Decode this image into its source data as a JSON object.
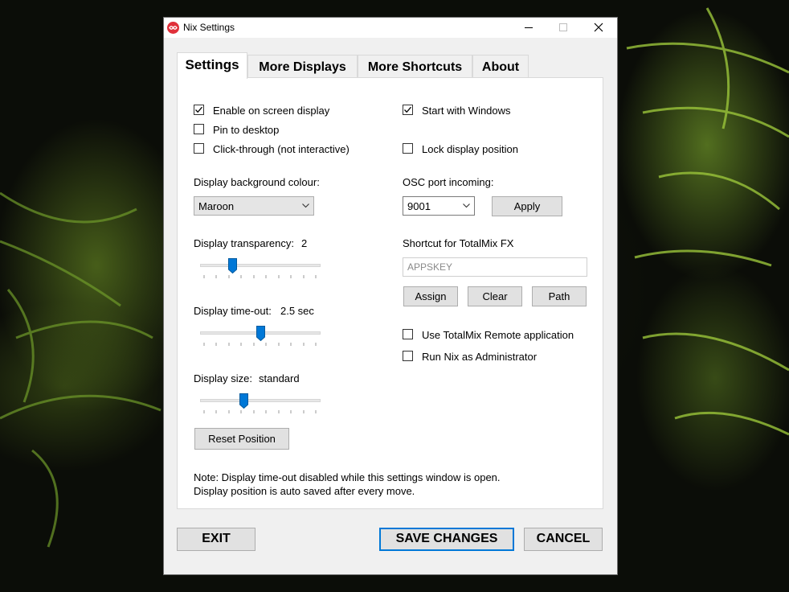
{
  "window": {
    "title": "Nix Settings"
  },
  "tabs": [
    "Settings",
    "More Displays",
    "More Shortcuts",
    "About"
  ],
  "settings": {
    "enable_osd": {
      "label": "Enable on screen display",
      "checked": true
    },
    "pin_desktop": {
      "label": "Pin to desktop",
      "checked": false
    },
    "click_through": {
      "label": "Click-through (not interactive)",
      "checked": false
    },
    "start_windows": {
      "label": "Start with Windows",
      "checked": true
    },
    "lock_position": {
      "label": "Lock display position",
      "checked": false
    },
    "bg_colour": {
      "label": "Display background colour:",
      "value": "Maroon"
    },
    "osc_port": {
      "label": "OSC port incoming:",
      "value": "9001",
      "apply_label": "Apply"
    },
    "transparency": {
      "label": "Display transparency:",
      "value": "2",
      "fraction": 0.25
    },
    "timeout": {
      "label": "Display time-out:",
      "value": "2.5 sec",
      "fraction": 0.5
    },
    "size": {
      "label": "Display size:",
      "value": "standard",
      "fraction": 0.35
    },
    "shortcut": {
      "label": "Shortcut for TotalMix FX",
      "value": "APPSKEY",
      "assign": "Assign",
      "clear": "Clear",
      "path": "Path"
    },
    "use_remote": {
      "label": "Use TotalMix Remote application",
      "checked": false
    },
    "run_admin": {
      "label": "Run Nix as Administrator",
      "checked": false
    },
    "reset_position": "Reset Position",
    "note_line1": "Note: Display time-out disabled while this settings window is open.",
    "note_line2": "Display position is auto saved after every move."
  },
  "footer": {
    "exit": "EXIT",
    "save": "SAVE CHANGES",
    "cancel": "CANCEL"
  }
}
